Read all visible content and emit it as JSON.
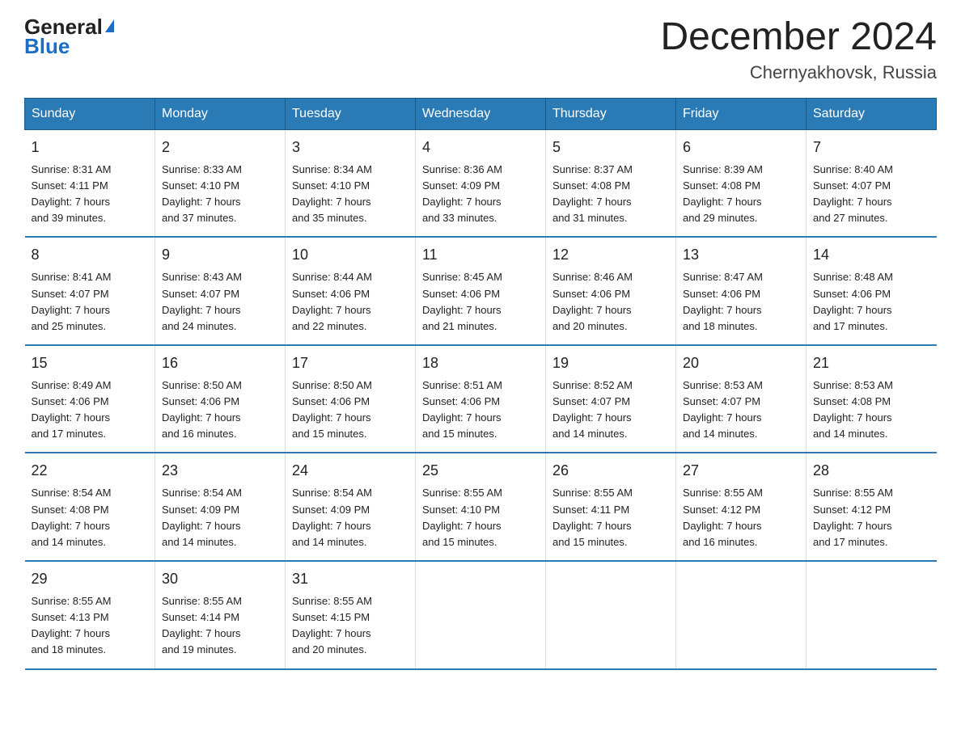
{
  "logo": {
    "general": "General",
    "blue": "Blue",
    "triangle": "▲"
  },
  "title": "December 2024",
  "subtitle": "Chernyakhovsk, Russia",
  "days_of_week": [
    "Sunday",
    "Monday",
    "Tuesday",
    "Wednesday",
    "Thursday",
    "Friday",
    "Saturday"
  ],
  "weeks": [
    [
      {
        "day": "1",
        "sunrise": "8:31 AM",
        "sunset": "4:11 PM",
        "daylight_hours": "7",
        "daylight_minutes": "39"
      },
      {
        "day": "2",
        "sunrise": "8:33 AM",
        "sunset": "4:10 PM",
        "daylight_hours": "7",
        "daylight_minutes": "37"
      },
      {
        "day": "3",
        "sunrise": "8:34 AM",
        "sunset": "4:10 PM",
        "daylight_hours": "7",
        "daylight_minutes": "35"
      },
      {
        "day": "4",
        "sunrise": "8:36 AM",
        "sunset": "4:09 PM",
        "daylight_hours": "7",
        "daylight_minutes": "33"
      },
      {
        "day": "5",
        "sunrise": "8:37 AM",
        "sunset": "4:08 PM",
        "daylight_hours": "7",
        "daylight_minutes": "31"
      },
      {
        "day": "6",
        "sunrise": "8:39 AM",
        "sunset": "4:08 PM",
        "daylight_hours": "7",
        "daylight_minutes": "29"
      },
      {
        "day": "7",
        "sunrise": "8:40 AM",
        "sunset": "4:07 PM",
        "daylight_hours": "7",
        "daylight_minutes": "27"
      }
    ],
    [
      {
        "day": "8",
        "sunrise": "8:41 AM",
        "sunset": "4:07 PM",
        "daylight_hours": "7",
        "daylight_minutes": "25"
      },
      {
        "day": "9",
        "sunrise": "8:43 AM",
        "sunset": "4:07 PM",
        "daylight_hours": "7",
        "daylight_minutes": "24"
      },
      {
        "day": "10",
        "sunrise": "8:44 AM",
        "sunset": "4:06 PM",
        "daylight_hours": "7",
        "daylight_minutes": "22"
      },
      {
        "day": "11",
        "sunrise": "8:45 AM",
        "sunset": "4:06 PM",
        "daylight_hours": "7",
        "daylight_minutes": "21"
      },
      {
        "day": "12",
        "sunrise": "8:46 AM",
        "sunset": "4:06 PM",
        "daylight_hours": "7",
        "daylight_minutes": "20"
      },
      {
        "day": "13",
        "sunrise": "8:47 AM",
        "sunset": "4:06 PM",
        "daylight_hours": "7",
        "daylight_minutes": "18"
      },
      {
        "day": "14",
        "sunrise": "8:48 AM",
        "sunset": "4:06 PM",
        "daylight_hours": "7",
        "daylight_minutes": "17"
      }
    ],
    [
      {
        "day": "15",
        "sunrise": "8:49 AM",
        "sunset": "4:06 PM",
        "daylight_hours": "7",
        "daylight_minutes": "17"
      },
      {
        "day": "16",
        "sunrise": "8:50 AM",
        "sunset": "4:06 PM",
        "daylight_hours": "7",
        "daylight_minutes": "16"
      },
      {
        "day": "17",
        "sunrise": "8:50 AM",
        "sunset": "4:06 PM",
        "daylight_hours": "7",
        "daylight_minutes": "15"
      },
      {
        "day": "18",
        "sunrise": "8:51 AM",
        "sunset": "4:06 PM",
        "daylight_hours": "7",
        "daylight_minutes": "15"
      },
      {
        "day": "19",
        "sunrise": "8:52 AM",
        "sunset": "4:07 PM",
        "daylight_hours": "7",
        "daylight_minutes": "14"
      },
      {
        "day": "20",
        "sunrise": "8:53 AM",
        "sunset": "4:07 PM",
        "daylight_hours": "7",
        "daylight_minutes": "14"
      },
      {
        "day": "21",
        "sunrise": "8:53 AM",
        "sunset": "4:08 PM",
        "daylight_hours": "7",
        "daylight_minutes": "14"
      }
    ],
    [
      {
        "day": "22",
        "sunrise": "8:54 AM",
        "sunset": "4:08 PM",
        "daylight_hours": "7",
        "daylight_minutes": "14"
      },
      {
        "day": "23",
        "sunrise": "8:54 AM",
        "sunset": "4:09 PM",
        "daylight_hours": "7",
        "daylight_minutes": "14"
      },
      {
        "day": "24",
        "sunrise": "8:54 AM",
        "sunset": "4:09 PM",
        "daylight_hours": "7",
        "daylight_minutes": "14"
      },
      {
        "day": "25",
        "sunrise": "8:55 AM",
        "sunset": "4:10 PM",
        "daylight_hours": "7",
        "daylight_minutes": "15"
      },
      {
        "day": "26",
        "sunrise": "8:55 AM",
        "sunset": "4:11 PM",
        "daylight_hours": "7",
        "daylight_minutes": "15"
      },
      {
        "day": "27",
        "sunrise": "8:55 AM",
        "sunset": "4:12 PM",
        "daylight_hours": "7",
        "daylight_minutes": "16"
      },
      {
        "day": "28",
        "sunrise": "8:55 AM",
        "sunset": "4:12 PM",
        "daylight_hours": "7",
        "daylight_minutes": "17"
      }
    ],
    [
      {
        "day": "29",
        "sunrise": "8:55 AM",
        "sunset": "4:13 PM",
        "daylight_hours": "7",
        "daylight_minutes": "18"
      },
      {
        "day": "30",
        "sunrise": "8:55 AM",
        "sunset": "4:14 PM",
        "daylight_hours": "7",
        "daylight_minutes": "19"
      },
      {
        "day": "31",
        "sunrise": "8:55 AM",
        "sunset": "4:15 PM",
        "daylight_hours": "7",
        "daylight_minutes": "20"
      },
      null,
      null,
      null,
      null
    ]
  ]
}
